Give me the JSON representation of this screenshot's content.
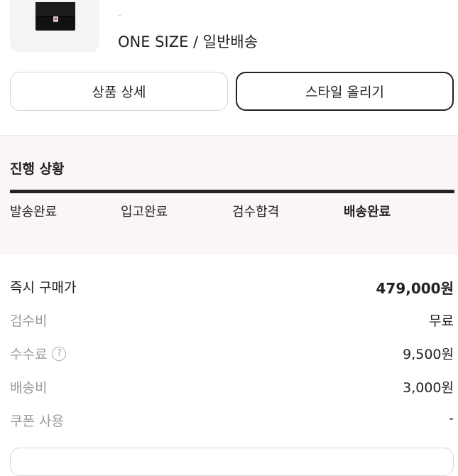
{
  "product": {
    "image_icon": "messenger-bag-icon",
    "cut_text": "-",
    "option": "ONE SIZE / 일반배송"
  },
  "actions": {
    "detail_label": "상품 상세",
    "style_label": "스타일 올리기"
  },
  "status": {
    "title": "진행 상황",
    "progress_fraction": 1.0,
    "steps": [
      "발송완료",
      "입고완료",
      "검수합격",
      "배송완료"
    ],
    "active_step": 3
  },
  "price": {
    "buy_now_label": "즉시 구매가",
    "buy_now_value": "479,000원",
    "inspection_label": "검수비",
    "inspection_value": "무료",
    "fee_label": "수수료",
    "fee_help_icon": "question-circle-icon",
    "fee_help_glyph": "?",
    "fee_value": "9,500원",
    "shipping_label": "배송비",
    "shipping_value": "3,000원",
    "coupon_label": "쿠폰 사용",
    "coupon_value": "-"
  }
}
